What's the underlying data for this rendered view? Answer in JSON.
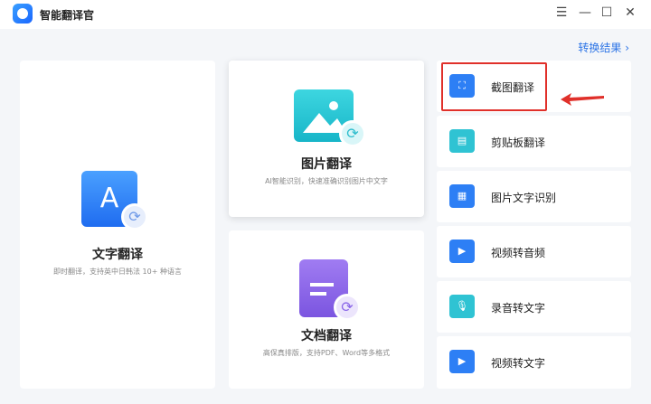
{
  "app": {
    "title": "智能翻译官"
  },
  "window": {
    "menu": "☰",
    "minimize": "—",
    "maximize": "☐",
    "close": "✕"
  },
  "results_link": "转换结果 ›",
  "cards": {
    "text": {
      "title": "文字翻译",
      "desc": "即时翻译，支持英中日韩法 10+ 种语言",
      "icon": "A"
    },
    "image": {
      "title": "图片翻译",
      "desc": "AI智能识别，快速准确识别图片中文字"
    },
    "doc": {
      "title": "文档翻译",
      "desc": "高保真排版，支持PDF、Word等多格式"
    }
  },
  "tools": [
    {
      "label": "截图翻译",
      "icon": "screenshot-translate-icon"
    },
    {
      "label": "剪贴板翻译",
      "icon": "clipboard-translate-icon"
    },
    {
      "label": "图片文字识别",
      "icon": "image-ocr-icon"
    },
    {
      "label": "视频转音频",
      "icon": "video-to-audio-icon"
    },
    {
      "label": "录音转文字",
      "icon": "recording-to-text-icon"
    },
    {
      "label": "视频转文字",
      "icon": "video-to-text-icon"
    }
  ],
  "colors": {
    "accent": "#2d7ff5",
    "highlight": "#e0302a"
  }
}
